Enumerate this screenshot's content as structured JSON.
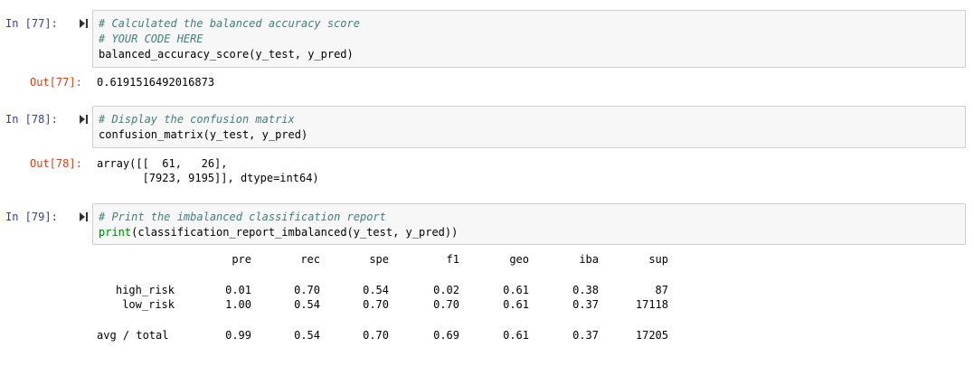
{
  "cells": [
    {
      "in_prompt": "In [77]:",
      "code": {
        "comment1": "# Calculated the balanced accuracy score",
        "comment2": "# YOUR CODE HERE",
        "line3": "balanced_accuracy_score(y_test, y_pred)"
      },
      "out_prompt": "Out[77]:",
      "output": "0.6191516492016873"
    },
    {
      "in_prompt": "In [78]:",
      "code": {
        "comment1": "# Display the confusion matrix",
        "line2": "confusion_matrix(y_test, y_pred)"
      },
      "out_prompt": "Out[78]:",
      "output_line1": "array([[  61,   26],",
      "output_line2": "       [7923, 9195]], dtype=int64)"
    },
    {
      "in_prompt": "In [79]:",
      "code": {
        "comment1": "# Print the imbalanced classification report",
        "print": "print",
        "print_args": "(classification_report_imbalanced(y_test, y_pred))"
      },
      "report": {
        "headers": [
          "pre",
          "rec",
          "spe",
          "f1",
          "geo",
          "iba",
          "sup"
        ],
        "rows": [
          {
            "label": "high_risk",
            "values": [
              "0.01",
              "0.70",
              "0.54",
              "0.02",
              "0.61",
              "0.38",
              "87"
            ]
          },
          {
            "label": "low_risk",
            "values": [
              "1.00",
              "0.54",
              "0.70",
              "0.70",
              "0.61",
              "0.37",
              "17118"
            ]
          },
          {
            "label": "avg / total",
            "values": [
              "0.99",
              "0.54",
              "0.70",
              "0.69",
              "0.61",
              "0.37",
              "17205"
            ]
          }
        ]
      }
    }
  ],
  "icons": {
    "run": "run-cell-icon"
  }
}
